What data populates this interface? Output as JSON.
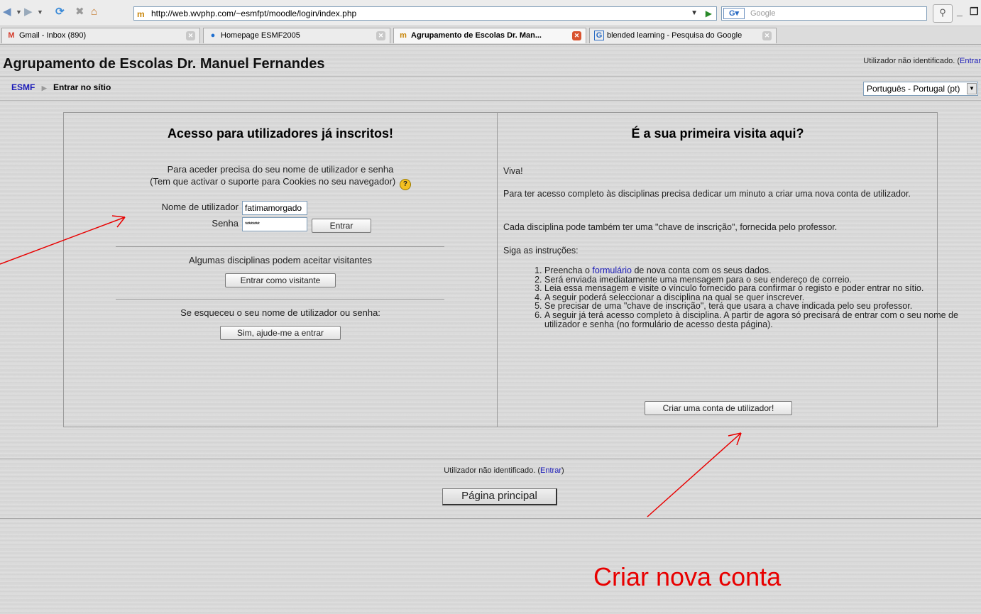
{
  "browser": {
    "url": "http://web.wvphp.com/~esmfpt/moodle/login/index.php",
    "search_placeholder": "Google",
    "tabs": [
      {
        "label": "Gmail - Inbox (890)",
        "icon": "gmail-icon",
        "active": false
      },
      {
        "label": "Homepage ESMF2005",
        "icon": "chrome-icon",
        "active": false
      },
      {
        "label": "Agrupamento de Escolas Dr. Man...",
        "icon": "moodle-icon",
        "active": true
      },
      {
        "label": "blended learning - Pesquisa do Google",
        "icon": "google-icon",
        "active": false
      }
    ]
  },
  "header": {
    "site_title": "Agrupamento de Escolas Dr. Manuel Fernandes",
    "login_status": "Utilizador não identificado. (",
    "login_link": "Entrar",
    "breadcrumb_root": "ESMF",
    "breadcrumb_current": "Entrar no sítio",
    "language": "Português - Portugal (pt)"
  },
  "login": {
    "heading": "Acesso para utilizadores já inscritos!",
    "intro_line1": "Para aceder precisa do seu nome de utilizador e senha",
    "intro_line2": "(Tem que activar o suporte para Cookies no seu navegador)",
    "username_label": "Nome de utilizador",
    "username_value": "fatimamorgado",
    "password_label": "Senha",
    "password_value": "********",
    "login_button": "Entrar",
    "guest_text": "Algumas disciplinas podem aceitar visitantes",
    "guest_button": "Entrar como visitante",
    "forgot_text": "Se esqueceu o seu nome de utilizador ou senha:",
    "forgot_button": "Sim, ajude-me a entrar"
  },
  "signup": {
    "heading": "É a sua primeira visita aqui?",
    "greeting": "Viva!",
    "para1": "Para ter acesso completo às disciplinas precisa dedicar um minuto a criar uma nova conta de utilizador.",
    "para2": "Cada disciplina pode também ter uma \"chave de inscrição\", fornecida pelo professor.",
    "para3": "Siga as instruções:",
    "step1_before": "Preencha o ",
    "step1_link": "formulário",
    "step1_after": " de nova conta com os seus dados.",
    "step2": "Será enviada imediatamente uma mensagem para o seu endereço de correio.",
    "step3": "Leia essa mensagem e visite o vínculo fornecido para confirmar o registo e poder entrar no sítio.",
    "step4": "A seguir poderá seleccionar a disciplina na qual se quer inscrever.",
    "step5": "Se precisar de uma \"chave de inscrição\", terá que usara a chave indicada pelo seu professor.",
    "step6": "A seguir já terá acesso completo à disciplina. A partir de agora só precisará de entrar com o seu nome de utilizador e senha (no formulário de acesso desta página).",
    "create_button": "Criar uma conta de utilizador!"
  },
  "footer": {
    "status": "Utilizador não identificado. (",
    "link": "Entrar",
    "home_button": "Página principal"
  },
  "annotation": {
    "label": "Criar nova conta",
    "color": "#e80000"
  }
}
